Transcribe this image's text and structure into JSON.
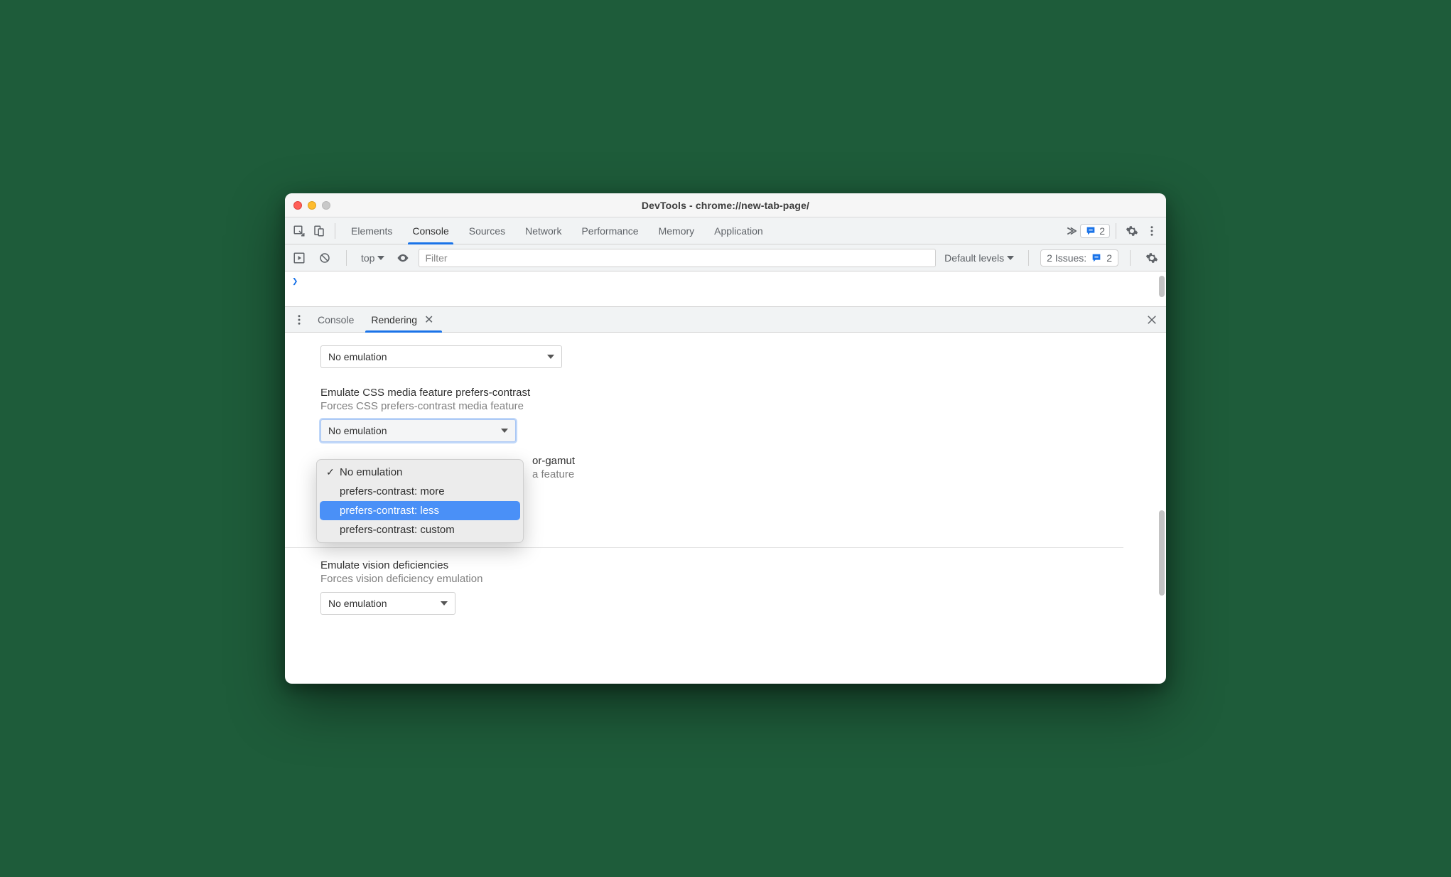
{
  "window": {
    "title": "DevTools - chrome://new-tab-page/"
  },
  "mainTabs": {
    "items": [
      "Elements",
      "Console",
      "Sources",
      "Network",
      "Performance",
      "Memory",
      "Application"
    ],
    "activeIndex": 1,
    "issuesBadge": "2"
  },
  "consoleFilter": {
    "context": "top",
    "filterPlaceholder": "Filter",
    "levels": "Default levels",
    "issuesLabel": "2 Issues:",
    "issuesCount": "2"
  },
  "drawer": {
    "tabs": [
      "Console",
      "Rendering"
    ],
    "activeIndex": 1
  },
  "rendering": {
    "select0": "No emulation",
    "contrast": {
      "label": "Emulate CSS media feature prefers-contrast",
      "desc": "Forces CSS prefers-contrast media feature",
      "selected": "No emulation",
      "options": [
        "No emulation",
        "prefers-contrast: more",
        "prefers-contrast: less",
        "prefers-contrast: custom"
      ],
      "checkedIndex": 0,
      "hoverIndex": 2
    },
    "gamut": {
      "label_tail": "or-gamut",
      "desc_tail": "a feature"
    },
    "vision": {
      "label": "Emulate vision deficiencies",
      "desc": "Forces vision deficiency emulation",
      "selected": "No emulation"
    }
  }
}
